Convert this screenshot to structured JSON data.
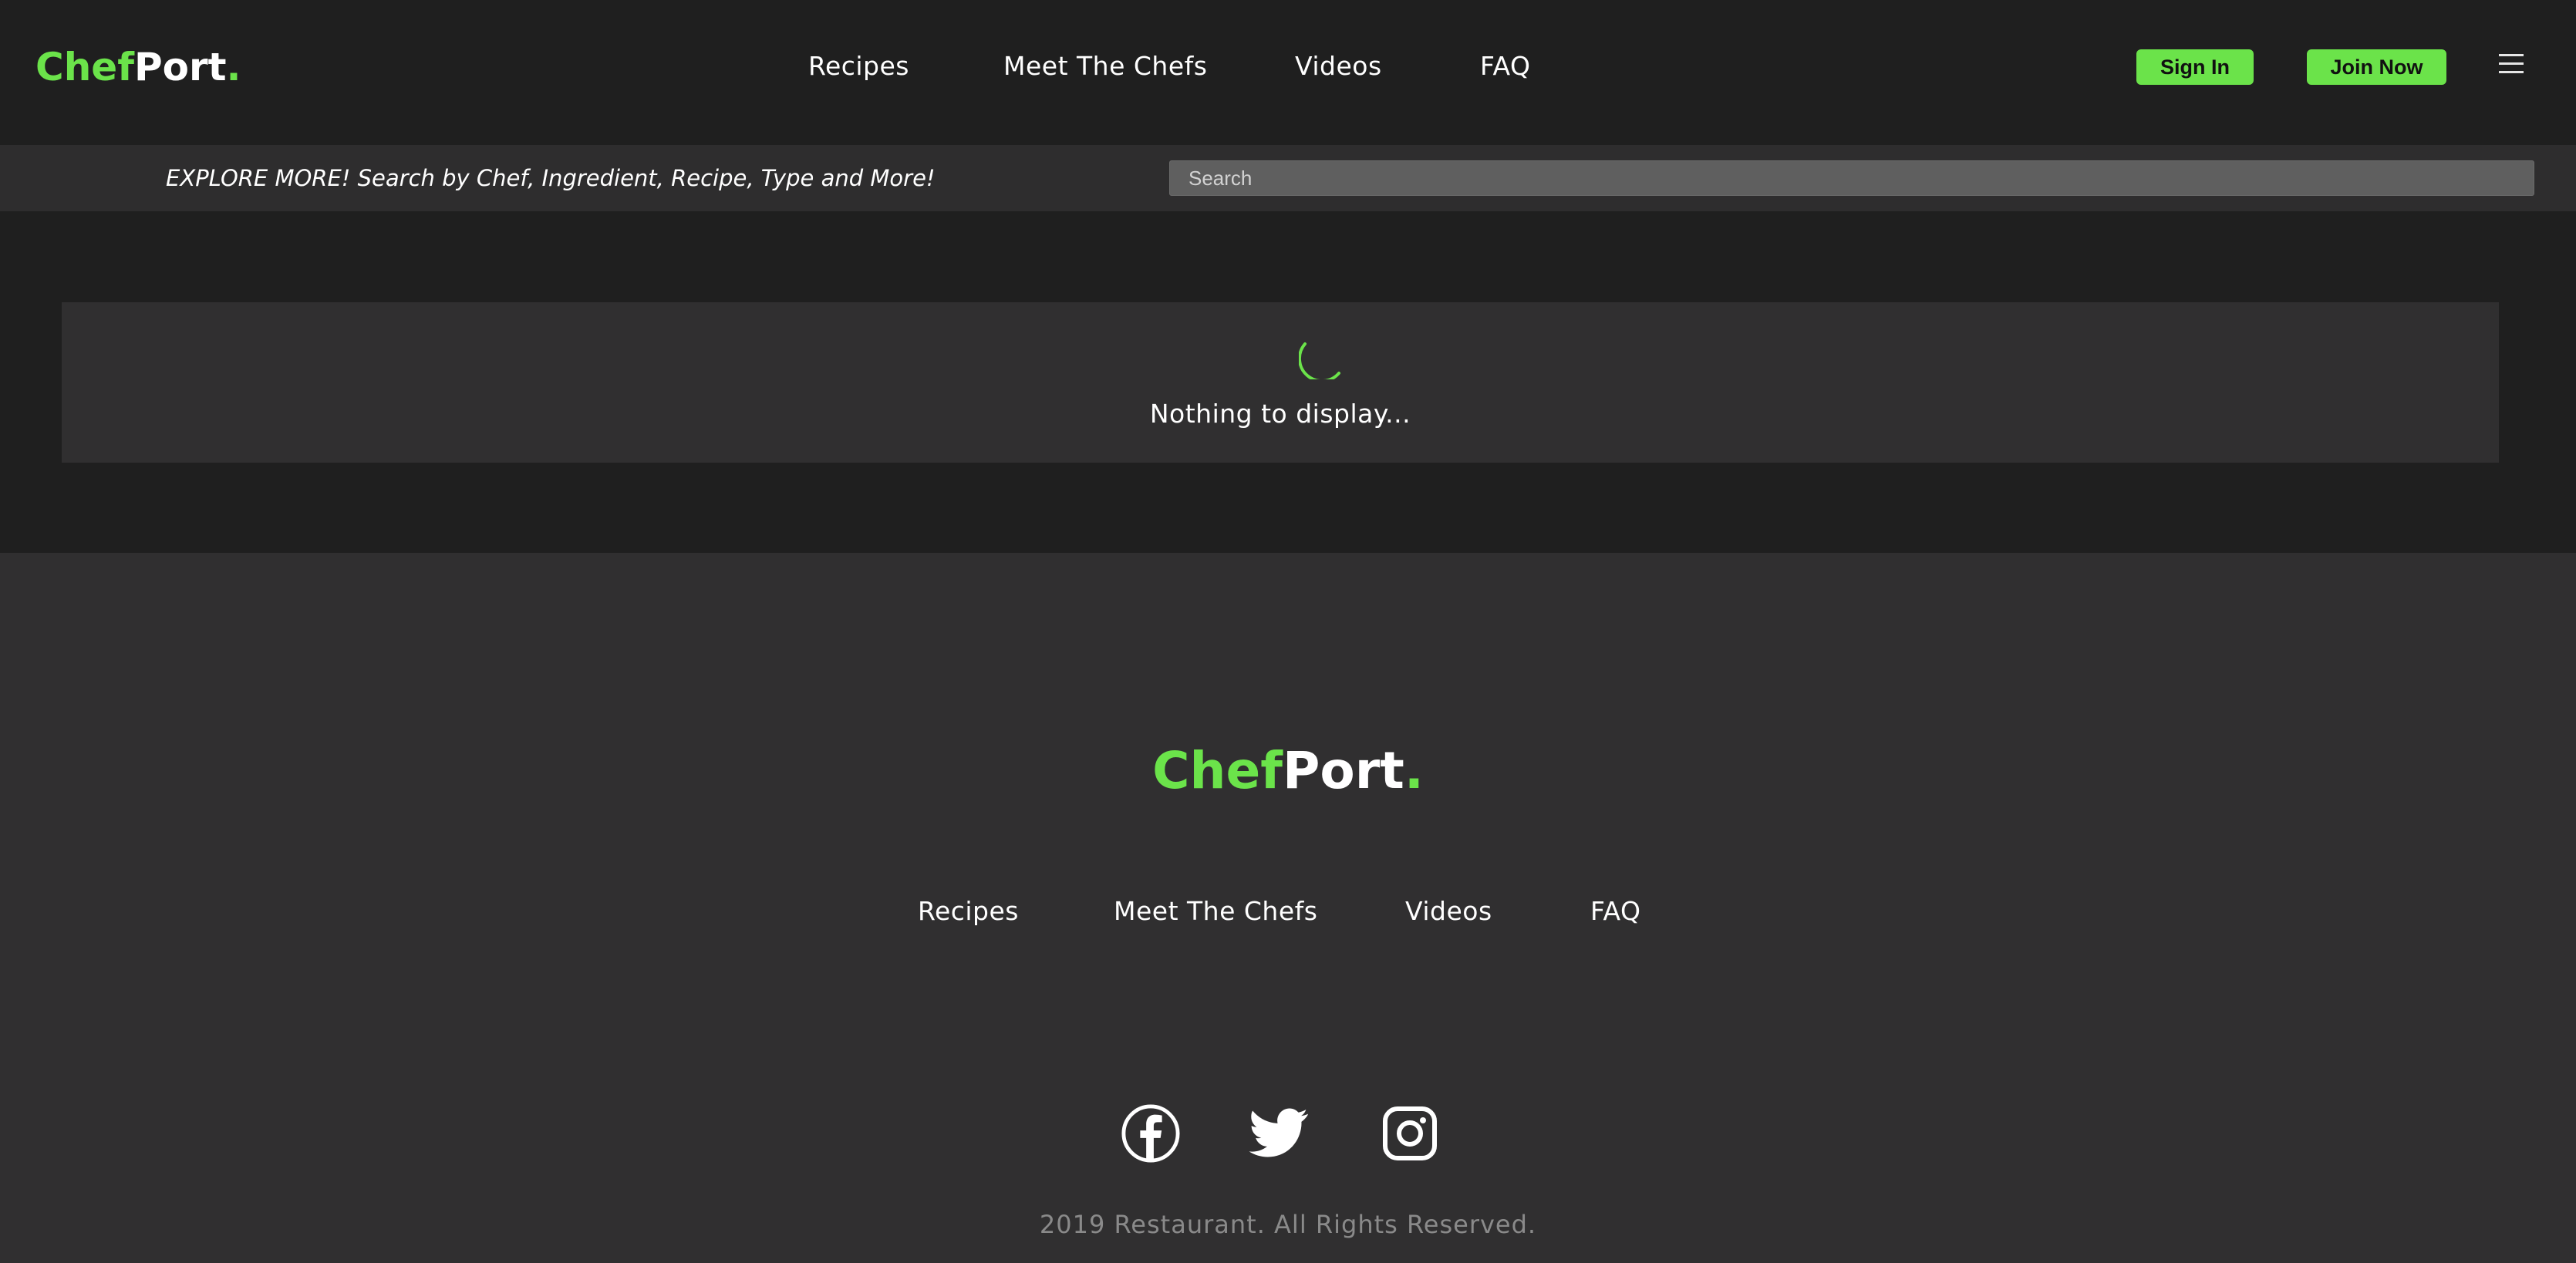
{
  "brand": {
    "chef": "Chef",
    "port": "Port",
    "dot": "."
  },
  "header": {
    "nav": [
      "Recipes",
      "Meet The Chefs",
      "Videos",
      "FAQ"
    ],
    "sign_in": "Sign In",
    "join_now": "Join Now"
  },
  "search": {
    "explore_text": "EXPLORE MORE! Search by Chef, Ingredient, Recipe, Type and More!",
    "placeholder": "Search"
  },
  "content": {
    "empty_message": "Nothing to display..."
  },
  "footer": {
    "nav": [
      "Recipes",
      "Meet The Chefs",
      "Videos",
      "FAQ"
    ],
    "social": [
      "facebook-icon",
      "twitter-icon",
      "instagram-icon"
    ],
    "copyright": "2019 Restaurant. All Rights Reserved."
  },
  "colors": {
    "accent": "#6be34a",
    "background": "#1f1f1f",
    "panel": "#302f30",
    "search_strip": "#2e2d2e"
  }
}
